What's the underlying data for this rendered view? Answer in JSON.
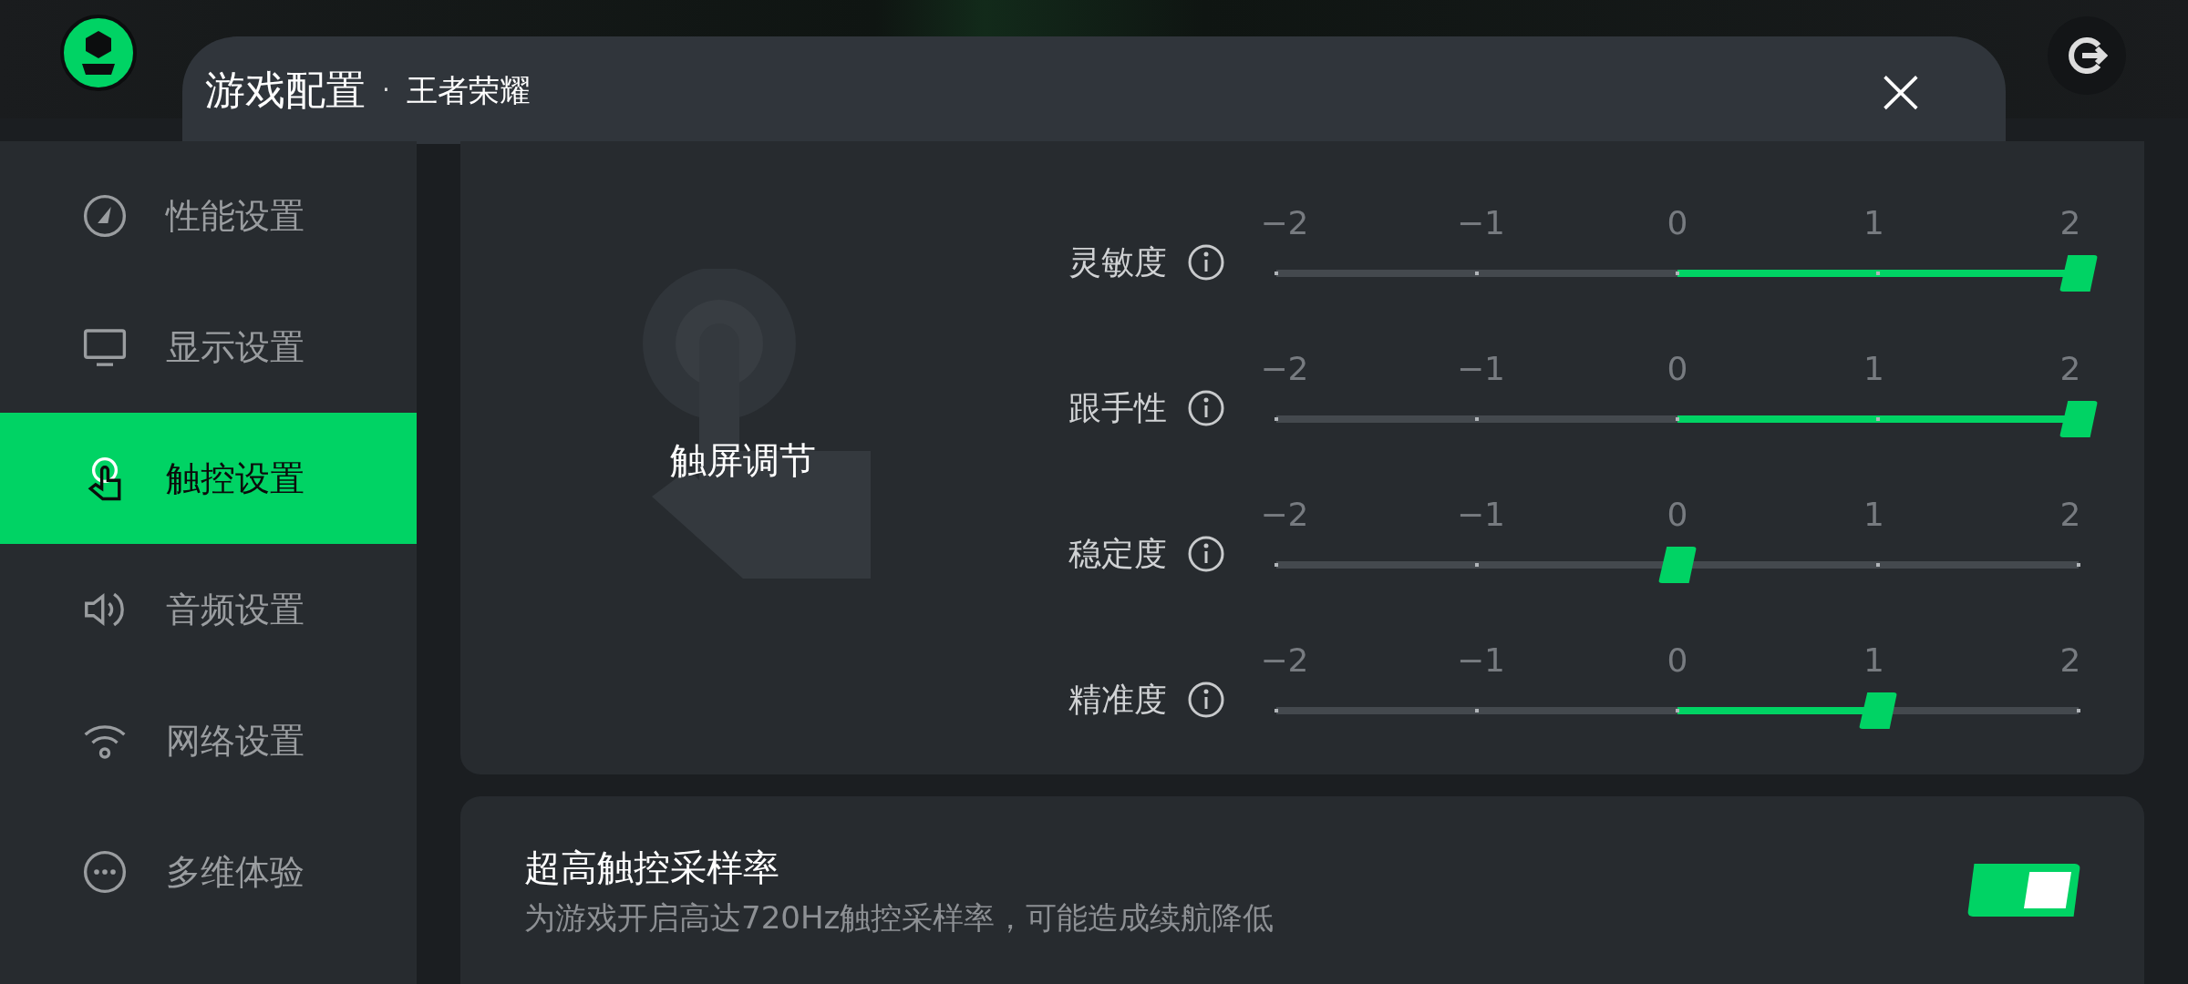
{
  "header": {
    "title": "游戏配置",
    "separator": "·",
    "game": "王者荣耀",
    "close": "×"
  },
  "sidebar": {
    "items": [
      {
        "label": "性能设置",
        "selected": false
      },
      {
        "label": "显示设置",
        "selected": false
      },
      {
        "label": "触控设置",
        "selected": true
      },
      {
        "label": "音频设置",
        "selected": false
      },
      {
        "label": "网络设置",
        "selected": false
      },
      {
        "label": "多维体验",
        "selected": false
      }
    ]
  },
  "touch_card": {
    "title": "触屏调节",
    "sliders": [
      {
        "label": "灵敏度",
        "ticks": [
          "−2",
          "−1",
          "0",
          "1",
          "2"
        ],
        "level": 1.0
      },
      {
        "label": "跟手性",
        "ticks": [
          "−2",
          "−1",
          "0",
          "1",
          "2"
        ],
        "level": 1.0
      },
      {
        "label": "稳定度",
        "ticks": [
          "−2",
          "−1",
          "0",
          "1",
          "2"
        ],
        "level": 0.5
      },
      {
        "label": "精准度",
        "ticks": [
          "−2",
          "−1",
          "0",
          "1",
          "2"
        ],
        "level": 0.75
      }
    ]
  },
  "sampling_card": {
    "title": "超高触控采样率",
    "description": "为游戏开启高达720Hz触控采样率，可能造成续航降低",
    "on": true
  }
}
